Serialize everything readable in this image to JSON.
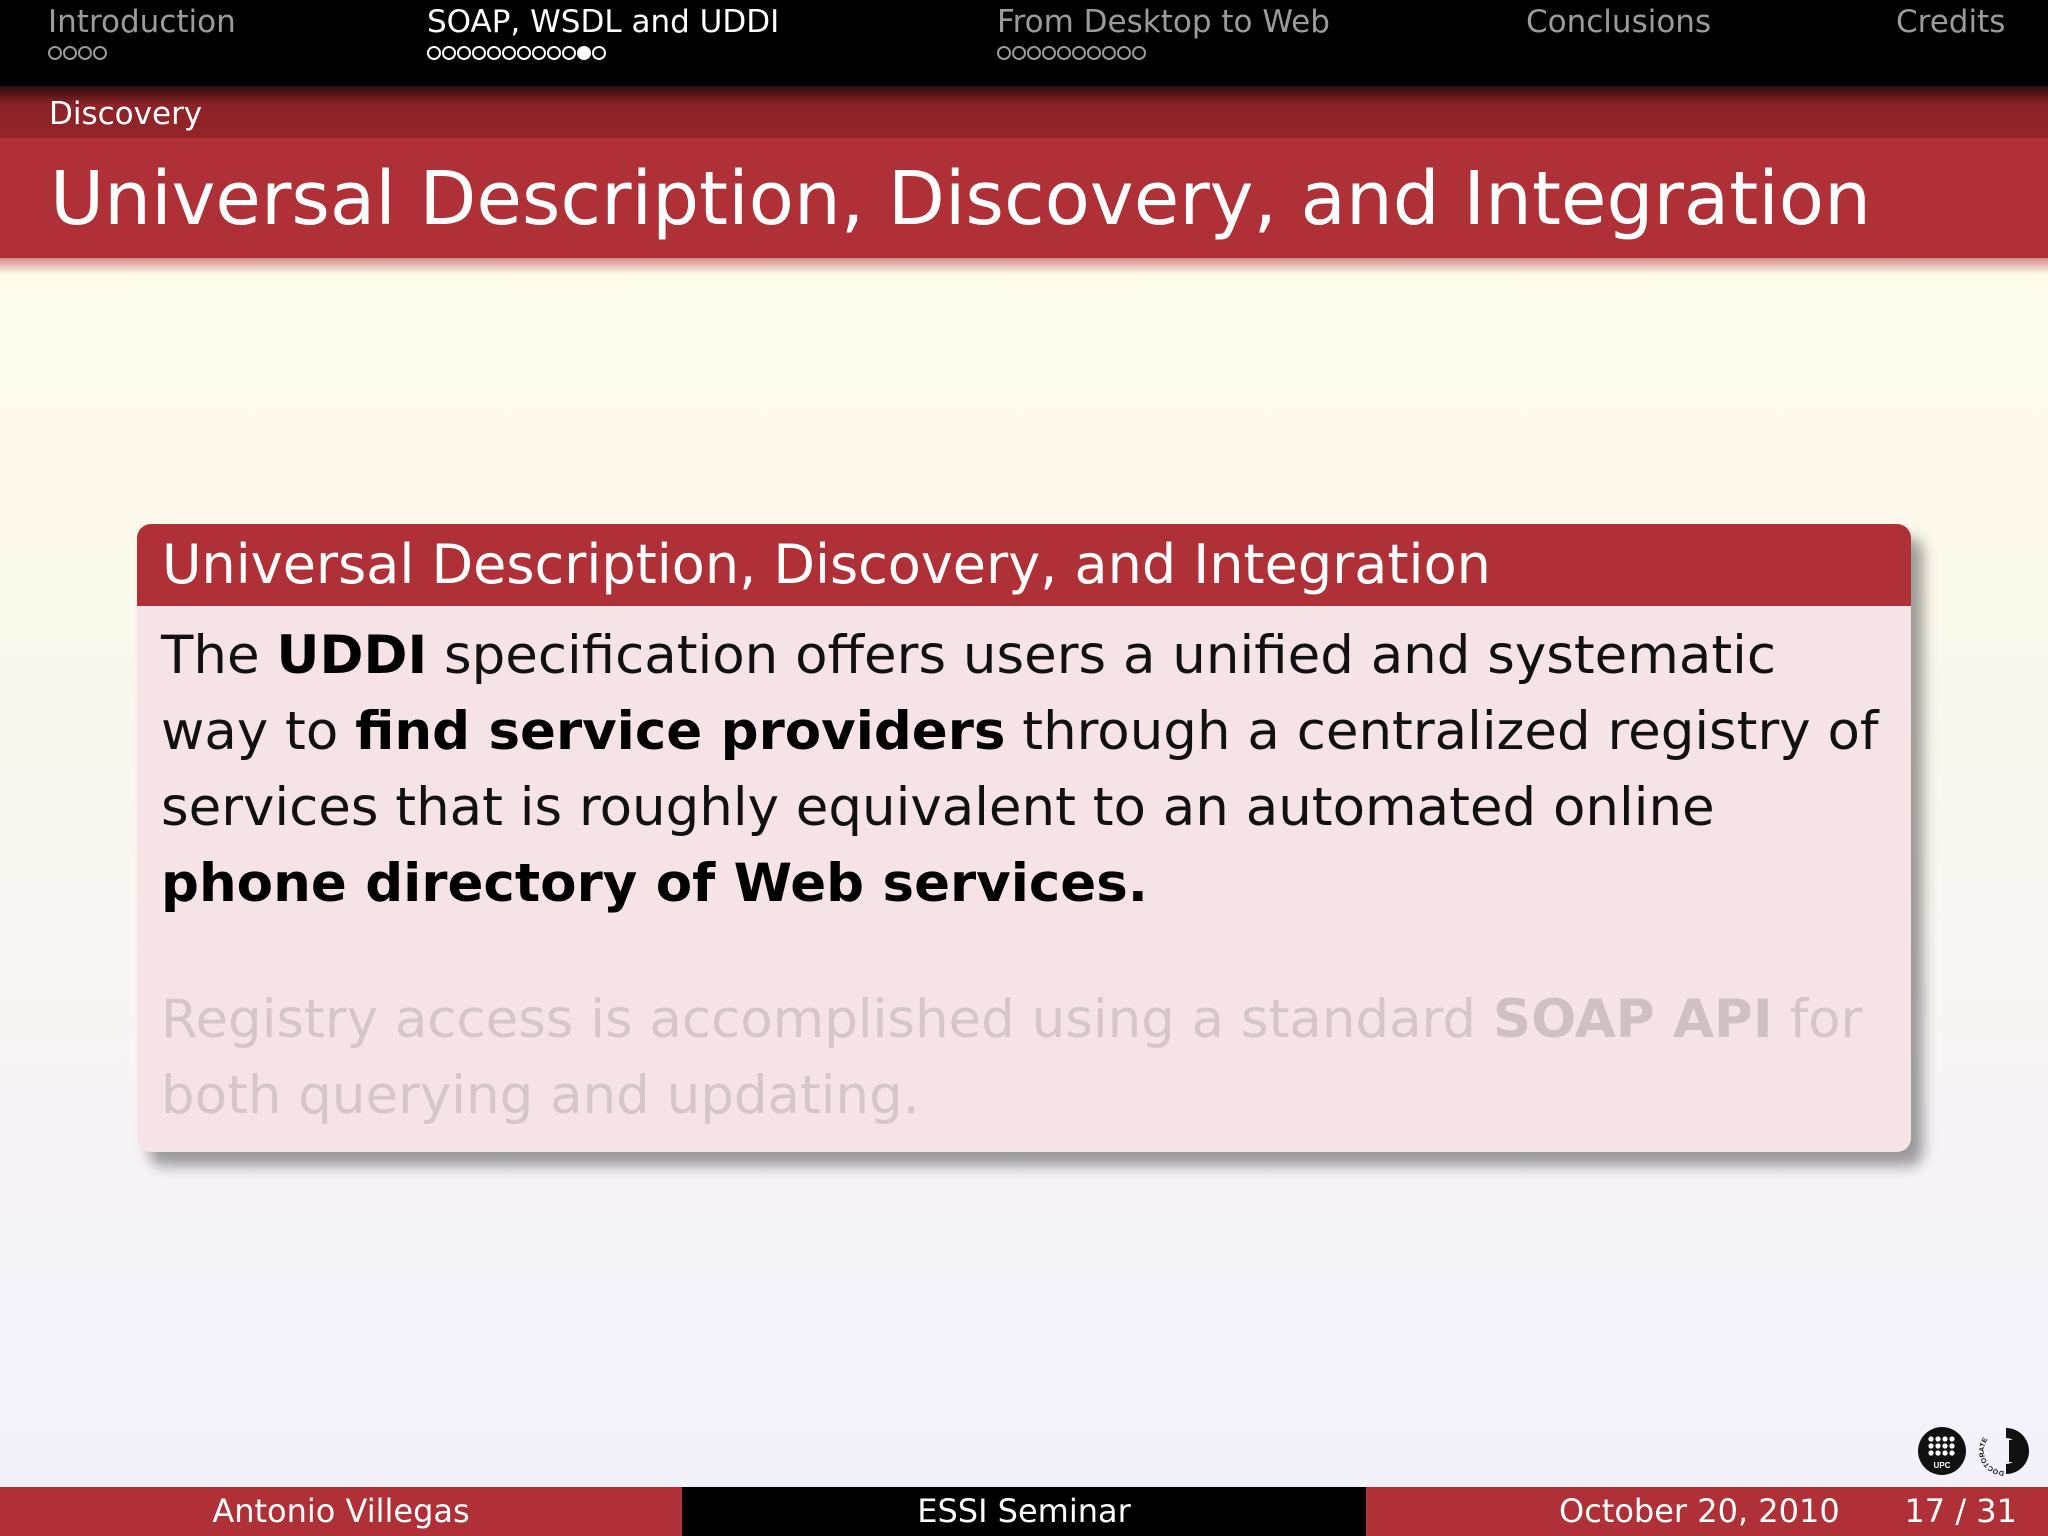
{
  "nav": {
    "sections": [
      {
        "title": "Introduction",
        "dots": 4,
        "filled": [],
        "active": false
      },
      {
        "title": "SOAP, WSDL and UDDI",
        "dots": 12,
        "filled": [
          10
        ],
        "active": true
      },
      {
        "title": "From Desktop to Web",
        "dots": 10,
        "filled": [],
        "active": false
      },
      {
        "title": "Conclusions",
        "dots": 0,
        "filled": [],
        "active": false
      },
      {
        "title": "Credits",
        "dots": 0,
        "filled": [],
        "active": false
      }
    ]
  },
  "subsection": "Discovery",
  "frame_title": "Universal Description, Discovery, and Integration",
  "block": {
    "title": "Universal Description, Discovery, and Integration",
    "para1": {
      "t1": "The ",
      "b1": "UDDI",
      "t2": " specification offers users a unified and systematic way to ",
      "b2": "find service providers",
      "t3": " through a centralized registry of services that is roughly equivalent to an automated online ",
      "b3": "phone directory of Web services."
    },
    "para2": {
      "t1": "Registry access is accomplished using a standard ",
      "b1": "SOAP API",
      "t2": " for both querying and updating."
    }
  },
  "footer": {
    "author": "Antonio Villegas",
    "event": "ESSI Seminar",
    "date": "October 20, 2010",
    "page": "17 / 31"
  },
  "logos": {
    "upc_text": "UPC",
    "doc_text": "DOCTORATE"
  },
  "colors": {
    "accent": "#b03037",
    "header_bg": "#000000",
    "block_body": "#f5e3e5"
  }
}
